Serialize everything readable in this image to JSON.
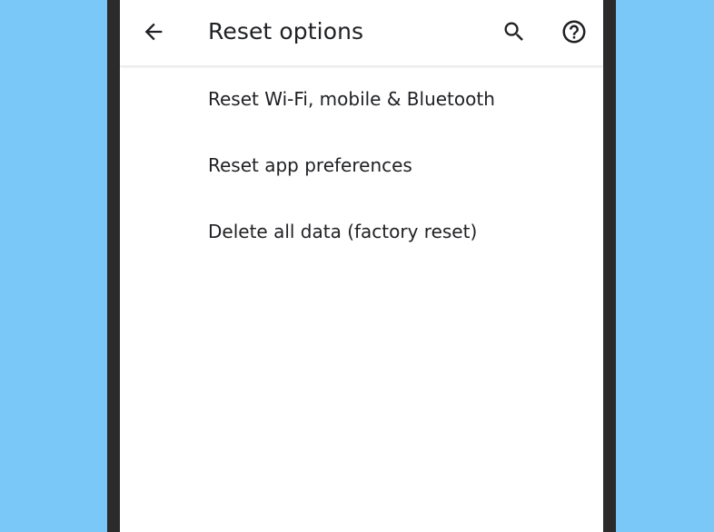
{
  "app_bar": {
    "title": "Reset options",
    "back_icon": "arrow-back-icon",
    "search_icon": "search-icon",
    "help_icon": "help-circle-icon"
  },
  "list": {
    "items": [
      {
        "label": "Reset Wi-Fi, mobile & Bluetooth"
      },
      {
        "label": "Reset app preferences"
      },
      {
        "label": "Delete all data (factory reset)"
      }
    ]
  },
  "colors": {
    "background": "#7ac8f8",
    "phone_frame": "#2b2b2b",
    "screen": "#ffffff",
    "text": "#202124"
  }
}
